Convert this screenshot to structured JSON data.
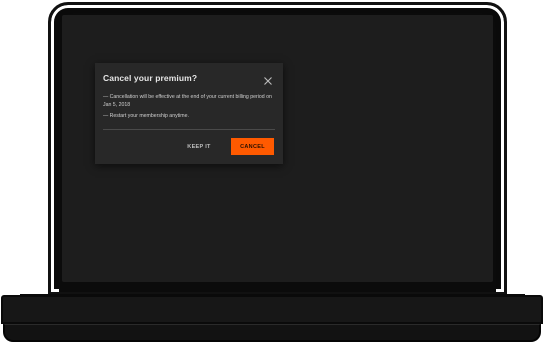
{
  "dialog": {
    "title": "Cancel your premium?",
    "close_icon": "close-icon",
    "lines": [
      "— Cancellation will be effective at the end of your current billing period on Jan 5, 2018",
      "— Restart your membership anytime."
    ],
    "keep_label": "KEEP IT",
    "cancel_label": "CANCEL"
  },
  "colors": {
    "accent": "#ff5a00",
    "dialog_bg": "#282828",
    "screen_bg": "#1d1d1d"
  }
}
